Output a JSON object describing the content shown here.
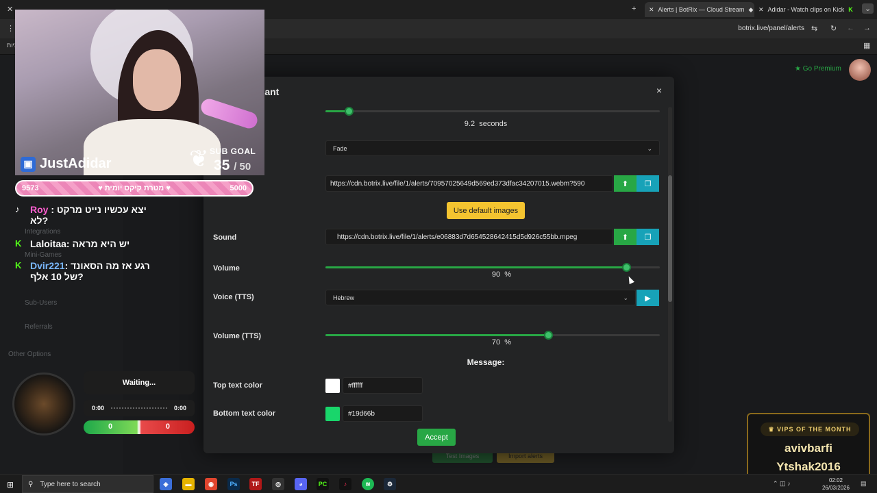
{
  "browser": {
    "tabs": [
      {
        "label": "Alerts | BotRix — Cloud Stream"
      },
      {
        "label": "Adidar - Watch clips on Kick"
      }
    ],
    "url": "botrix.live/panel/alerts",
    "bookmark_left": "ניות"
  },
  "page": {
    "go_premium": "Go Premium",
    "sidebar": [
      "Integrations",
      "Mini-Games",
      "Sub-Users",
      "Referrals",
      "Other Options"
    ],
    "bg_buttons": [
      "Test Images",
      "Import alerts"
    ]
  },
  "modal": {
    "title": "riant",
    "close": "×",
    "duration_value": "9.2",
    "duration_unit": "seconds",
    "duration_fraction": 0.07,
    "animation": "Fade",
    "image_url": "https://cdn.botrix.live/file/1/alerts/70957025649d569ed373dfac34207015.webm?590",
    "use_default": "Use default images",
    "sound_label": "Sound",
    "sound_url": "https://cdn.botrix.live/file/1/alerts/e06883d7d654528642415d5d926c55bb.mpeg",
    "volume_label": "Volume",
    "volume_value": "90",
    "volume_unit": "%",
    "volume_fraction": 0.9,
    "voice_label": "Voice (TTS)",
    "voice_value": "Hebrew",
    "tts_volume_label": "Volume (TTS)",
    "tts_volume_value": "70",
    "tts_volume_unit": "%",
    "tts_volume_fraction": 0.665,
    "message_header": "Message:",
    "top_color_label": "Top text color",
    "top_color_value": "#ffffff",
    "bottom_color_label": "Bottom text color",
    "bottom_color_value": "#19d66b",
    "accept": "Accept"
  },
  "overlay": {
    "streamer": "JustAdidar",
    "sub_goal_label": "SUB GOAL",
    "sub_goal_current": "35",
    "sub_goal_total": "/ 50",
    "goalbar_left": "9573",
    "goalbar_mid": "♥ מטרת קיקס יומית ♥",
    "goalbar_right": "5000",
    "chat": [
      {
        "user": "Roy",
        "platform": "tiktok",
        "color": "#ff5fd1",
        "text": "יצא עכשיו נייט מרקט",
        "text2": "לא?"
      },
      {
        "user": "Laloitaa",
        "platform": "kick",
        "color": "#ffffff",
        "text": "יש היא מראה",
        "text2": ""
      },
      {
        "user": "Dvir221",
        "platform": "kick",
        "color": "#7ab8ff",
        "text": "רגע אז מה הסאונד",
        "text2": "של 10 אלף?"
      }
    ],
    "player_status": "Waiting...",
    "time_left": "0:00",
    "time_right": "0:00",
    "score_left": "0",
    "score_right": "0",
    "vips_label": "VIPS OF THE MONTH",
    "vips": [
      "avivbarfi",
      "Ytshak2016"
    ]
  },
  "taskbar": {
    "search_placeholder": "Type here to search",
    "time": "02:02",
    "date": "26/03/2026"
  }
}
